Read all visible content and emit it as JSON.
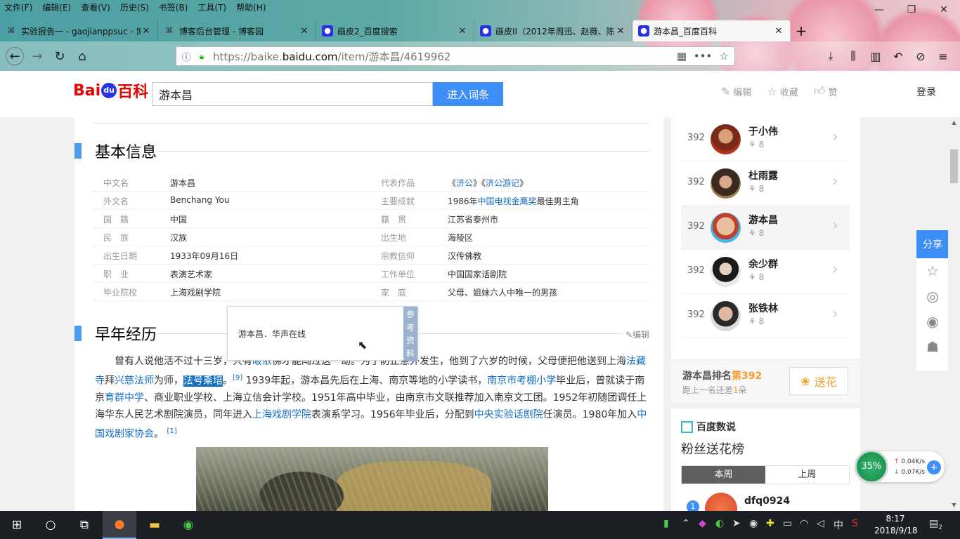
{
  "browser": {
    "menu": [
      "文件(F)",
      "编辑(E)",
      "查看(V)",
      "历史(S)",
      "书签(B)",
      "工具(T)",
      "帮助(H)"
    ],
    "tabs": [
      {
        "title": "实验报告一 - gaojianppsuc - 博"
      },
      {
        "title": "博客后台管理 - 博客园"
      },
      {
        "title": "画皮2_百度搜索"
      },
      {
        "title": "画皮II（2012年周迅、赵薇、陈"
      },
      {
        "title": "游本昌_百度百科"
      }
    ],
    "url_prefix": "https://baike.",
    "url_domain": "baidu.com",
    "url_path": "/item/游本昌/4619962"
  },
  "baike": {
    "logo_bai": "Bai",
    "logo_du": "du",
    "logo_baike": "百科",
    "search_value": "游本昌",
    "enter_button": "进入词条",
    "edit": "编辑",
    "collect": "收藏",
    "like": "赞",
    "login": "登录"
  },
  "basic_info": {
    "heading": "基本信息",
    "rows": [
      {
        "k1": "中文名",
        "v1": "游本昌",
        "k2": "代表作品",
        "v2": "《济公》《济公游记》"
      },
      {
        "k1": "外文名",
        "v1": "Benchang You",
        "k2": "主要成就",
        "v2": "1986年中国电视金鹰奖最佳男主角"
      },
      {
        "k1": "国　籍",
        "v1": "中国",
        "k2": "籍　贯",
        "v2": "江苏省泰州市"
      },
      {
        "k1": "民　族",
        "v1": "汉族",
        "k2": "出生地",
        "v2": "海陵区"
      },
      {
        "k1": "出生日期",
        "v1": "1933年09月16日",
        "k2": "宗教信仰",
        "v2": "汉传佛教"
      },
      {
        "k1": "职　业",
        "v1": "表演艺术家",
        "k2": "工作单位",
        "v2": "中国国家话剧院"
      },
      {
        "k1": "毕业院校",
        "v1": "上海戏剧学院",
        "k2": "家　庭",
        "v2": "父母、姐妹六人中唯一的男孩"
      }
    ]
  },
  "tooltip": {
    "text": "游本昌．华声在线",
    "side": "参考资料"
  },
  "early": {
    "heading": "早年经历",
    "edit": "编辑",
    "p": [
      "曾有人说他活不过十三岁，只有",
      "皈依",
      "佛才能闯过这一劫。为了防止意外发生，他到了六岁的时候，父母便把他送到上海",
      "法藏寺",
      "拜",
      "兴慈法师",
      "为师，",
      "法号乘培",
      "。",
      "[9]",
      " 1939年起，游本昌先后在上海、南京等地的小学读书，",
      "南京市考棚小学",
      "毕业后，曾就读于南京",
      "育群中学",
      "、商业职业学校、上海立信会计学校。1951年高中毕业，由南京市文联推荐加入南京文工团。1952年初随团调任上海华东人民艺术剧院演员，同年进入",
      "上海戏剧学院",
      "表演系学习。1956年毕业后，分配到",
      "中央实验话剧院",
      "任演员。1980年加入",
      "中国戏剧家协会",
      "。",
      "[1]"
    ]
  },
  "ranking": {
    "items": [
      {
        "rank": "392",
        "name": "于小伟",
        "flowers": "8"
      },
      {
        "rank": "392",
        "name": "杜雨露",
        "flowers": "8"
      },
      {
        "rank": "392",
        "name": "游本昌",
        "flowers": "8"
      },
      {
        "rank": "392",
        "name": "余少群",
        "flowers": "8"
      },
      {
        "rank": "392",
        "name": "张铁林",
        "flowers": "8"
      }
    ],
    "rank_label": "游本昌排名",
    "rank_value": "第392",
    "gap_prefix": "距上一名还差",
    "gap_value": "1",
    "gap_suffix": "朵",
    "send_button": "送花"
  },
  "data_card": {
    "brand": "百度数说",
    "title": "粉丝送花榜",
    "tab_week": "本周",
    "tab_last": "上周",
    "fan_rank": "1",
    "fan_name": "dfq0924"
  },
  "share": {
    "label": "分享"
  },
  "net_widget": {
    "percent": "35%",
    "up": "0.04K/s",
    "down": "0.07K/s"
  },
  "taskbar": {
    "ime": "中",
    "time": "8:17",
    "date": "2018/9/18",
    "notifications": "2"
  }
}
